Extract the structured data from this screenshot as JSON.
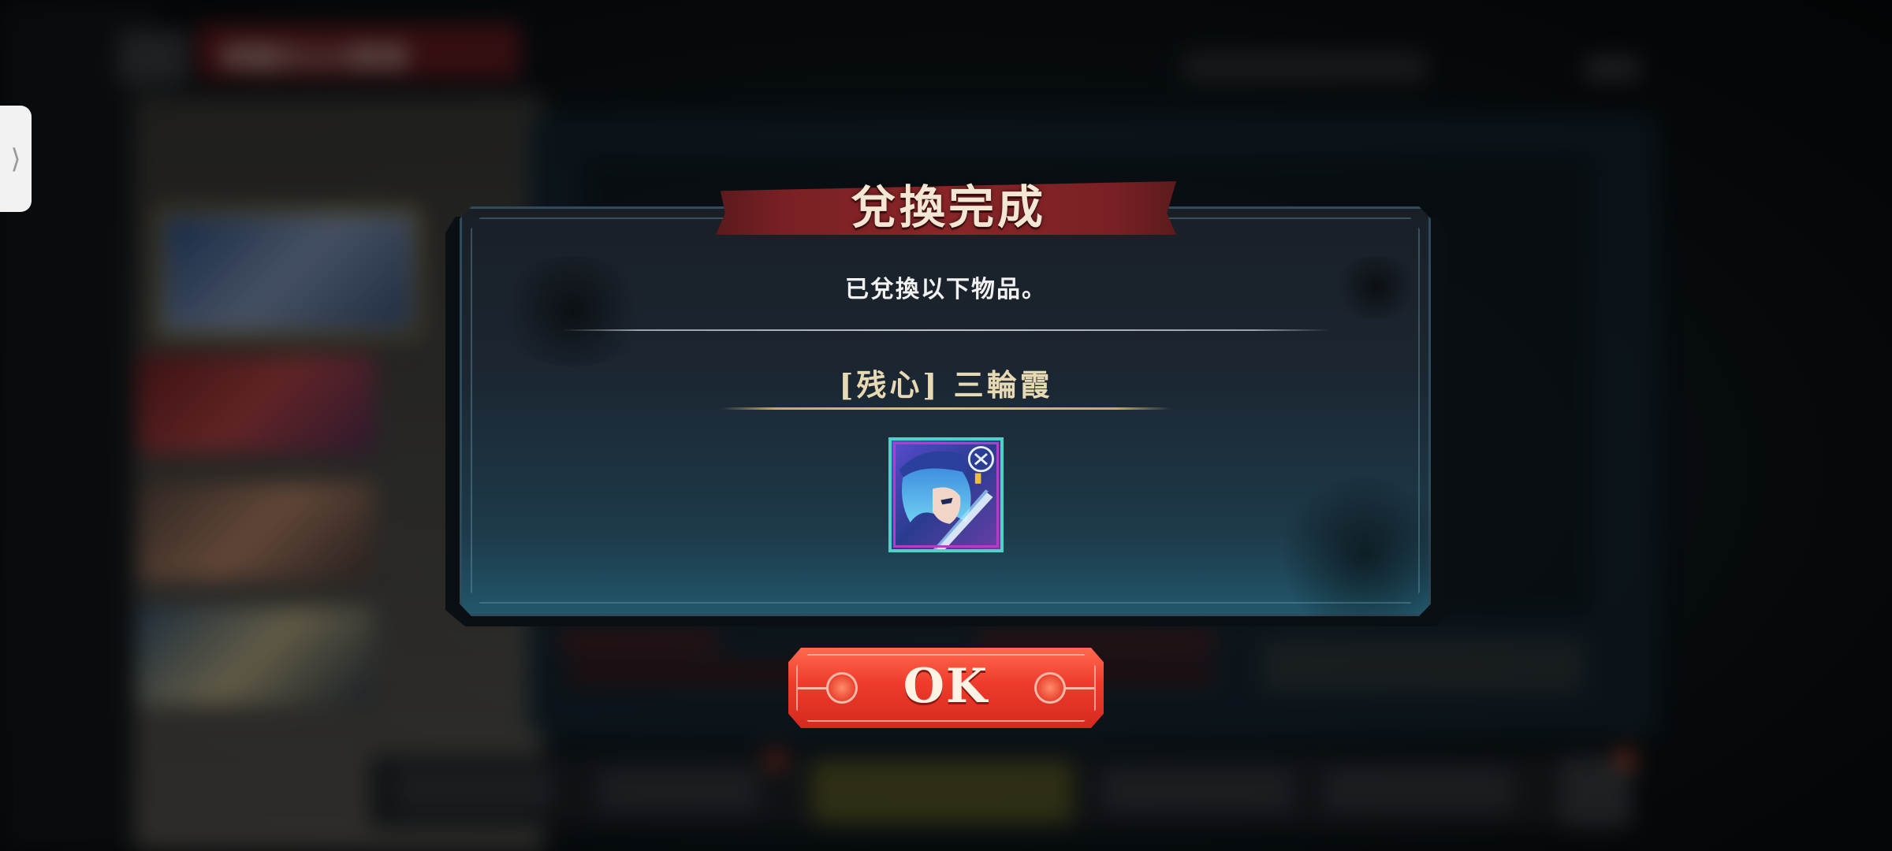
{
  "background": {
    "title_bar_text": "帰還兵士の勲章"
  },
  "side_handle": {
    "icon": "chevron-right-icon",
    "glyph": "⟩"
  },
  "dialog": {
    "title": "兌換完成",
    "message": "已兌換以下物品。",
    "item": {
      "name": "[残心] 三輪霞",
      "icon": "character-portrait-icon"
    }
  },
  "ok_button": {
    "label": "OK"
  },
  "colors": {
    "title_ribbon": "#7a2024",
    "ok_button": "#ee3b2b",
    "item_name": "#e8d9b5",
    "icon_frame": "#4fd1c5"
  }
}
